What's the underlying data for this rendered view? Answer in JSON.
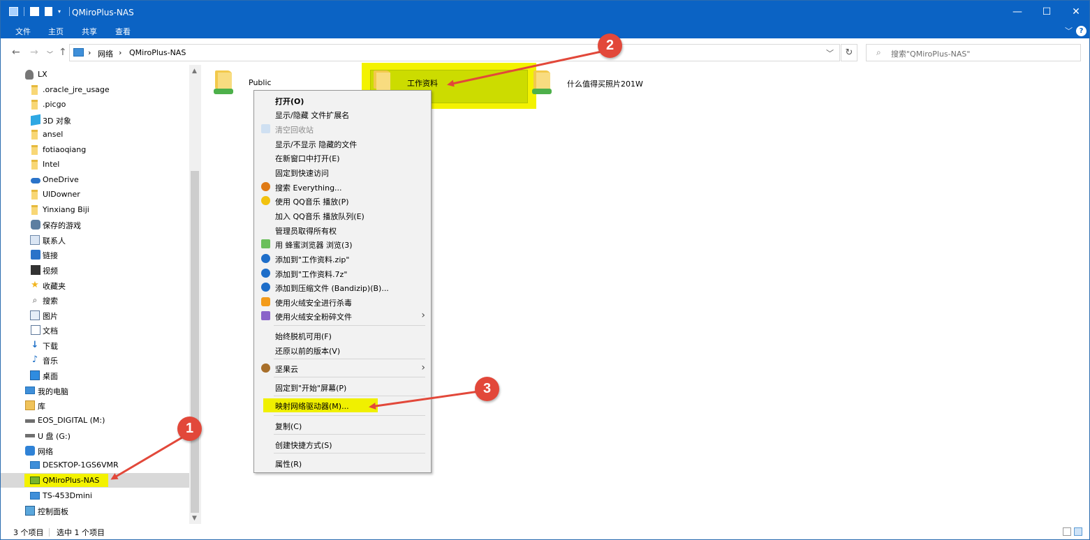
{
  "window": {
    "title": "QMiroPlus-NAS",
    "controls": {
      "minimize": "—",
      "maximize": "☐",
      "close": "✕"
    }
  },
  "ribbon": {
    "tabs": [
      "文件",
      "主页",
      "共享",
      "查看"
    ],
    "collapse": "﹀",
    "help": "?"
  },
  "address": {
    "back": "←",
    "forward": "→",
    "recent": "﹀",
    "up": "↑",
    "crumbs": [
      "›",
      "网络",
      "›",
      "QMiroPlus-NAS"
    ],
    "dropdown": "﹀",
    "refresh": "↻",
    "search_placeholder": "搜索\"QMiroPlus-NAS\""
  },
  "sidebar": {
    "items": [
      {
        "label": "LX",
        "icon": "user-icon"
      },
      {
        "label": ".oracle_jre_usage",
        "icon": "folder-icon"
      },
      {
        "label": ".picgo",
        "icon": "folder-icon"
      },
      {
        "label": "3D 对象",
        "icon": "cube-icon"
      },
      {
        "label": "ansel",
        "icon": "folder-icon"
      },
      {
        "label": "fotiaoqiang",
        "icon": "folder-icon"
      },
      {
        "label": "Intel",
        "icon": "folder-icon"
      },
      {
        "label": "OneDrive",
        "icon": "cloud-icon"
      },
      {
        "label": "UIDowner",
        "icon": "folder-icon"
      },
      {
        "label": "Yinxiang Biji",
        "icon": "folder-icon"
      },
      {
        "label": "保存的游戏",
        "icon": "game-icon"
      },
      {
        "label": "联系人",
        "icon": "contact-icon"
      },
      {
        "label": "链接",
        "icon": "link-icon"
      },
      {
        "label": "视频",
        "icon": "video-icon"
      },
      {
        "label": "收藏夹",
        "icon": "star-icon"
      },
      {
        "label": "搜索",
        "icon": "search-icon"
      },
      {
        "label": "图片",
        "icon": "picture-icon"
      },
      {
        "label": "文档",
        "icon": "document-icon"
      },
      {
        "label": "下载",
        "icon": "download-icon"
      },
      {
        "label": "音乐",
        "icon": "music-icon"
      },
      {
        "label": "桌面",
        "icon": "desktop-icon"
      },
      {
        "label": "我的电脑",
        "icon": "computer-icon"
      },
      {
        "label": "库",
        "icon": "library-icon"
      },
      {
        "label": "EOS_DIGITAL (M:)",
        "icon": "drive-icon"
      },
      {
        "label": "U 盘 (G:)",
        "icon": "drive-icon"
      },
      {
        "label": "网络",
        "icon": "network-icon"
      },
      {
        "label": "DESKTOP-1GS6VMR",
        "icon": "computer-icon"
      },
      {
        "label": "QMiroPlus-NAS",
        "icon": "nas-icon",
        "selected": true
      },
      {
        "label": "TS-453Dmini",
        "icon": "computer-icon"
      },
      {
        "label": "控制面板",
        "icon": "control-panel-icon"
      }
    ]
  },
  "content": {
    "folders": [
      {
        "label": "Public"
      },
      {
        "label": "工作资料"
      },
      {
        "label": "什么值得买照片201W"
      }
    ]
  },
  "context_menu": {
    "items": [
      {
        "label": "打开(O)",
        "bold": true
      },
      {
        "label": "显示/隐藏 文件扩展名"
      },
      {
        "label": "清空回收站",
        "disabled": true,
        "icon": "recycle-icon"
      },
      {
        "label": "显示/不显示 隐藏的文件"
      },
      {
        "label": "在新窗口中打开(E)"
      },
      {
        "label": "固定到快速访问"
      },
      {
        "label": "搜索 Everything...",
        "icon": "everything-icon"
      },
      {
        "label": "使用 QQ音乐 播放(P)",
        "icon": "qqmusic-icon"
      },
      {
        "label": "加入 QQ音乐 播放队列(E)"
      },
      {
        "label": "管理员取得所有权"
      },
      {
        "label": "用 蜂蜜浏览器 浏览(3)",
        "icon": "browser-icon"
      },
      {
        "label": "添加到\"工作资料.zip\"",
        "icon": "bandizip-icon"
      },
      {
        "label": "添加到\"工作资料.7z\"",
        "icon": "bandizip-icon"
      },
      {
        "label": "添加到压缩文件 (Bandizip)(B)...",
        "icon": "bandizip-icon"
      },
      {
        "label": "使用火绒安全进行杀毒",
        "icon": "huorong-icon"
      },
      {
        "label": "使用火绒安全粉碎文件",
        "icon": "shred-icon",
        "submenu": true
      },
      {
        "label": "始终脱机可用(F)"
      },
      {
        "label": "还原以前的版本(V)"
      },
      {
        "label": "坚果云",
        "icon": "jianguoyun-icon",
        "submenu": true
      },
      {
        "label": "固定到\"开始\"屏幕(P)"
      },
      {
        "label": "映射网络驱动器(M)...",
        "highlighted": true
      },
      {
        "label": "复制(C)"
      },
      {
        "label": "创建快捷方式(S)"
      },
      {
        "label": "属性(R)"
      }
    ],
    "submenu_arrow": "›"
  },
  "annotations": {
    "badges": [
      "1",
      "2",
      "3"
    ],
    "color": "#e2483a"
  },
  "status": {
    "count": "3 个项目",
    "selected": "选中 1 个项目"
  },
  "colors": {
    "titlebar": "#0b63c4",
    "highlight": "#f3f200",
    "selection": "#ccdc00"
  }
}
